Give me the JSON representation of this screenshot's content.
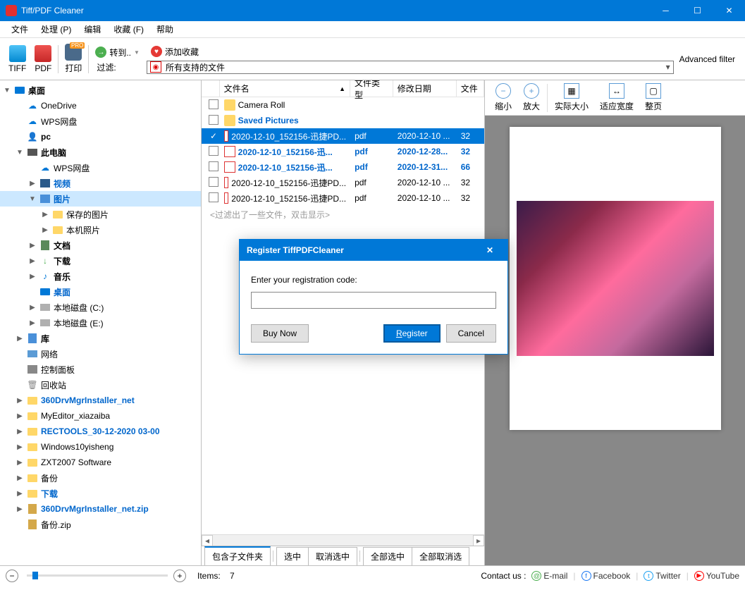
{
  "titlebar": {
    "title": "Tiff/PDF Cleaner"
  },
  "menu": [
    "文件",
    "处理 (P)",
    "编辑",
    "收藏 (F)",
    "帮助"
  ],
  "toolbar": {
    "tiff": "TIFF",
    "pdf": "PDF",
    "print": "打印",
    "pro": "PRO",
    "goto": "转到..",
    "addfav": "添加收藏",
    "filter_label": "过滤:",
    "filter_value": "所有支持的文件",
    "adv_filter": "Advanced filter"
  },
  "tree": [
    {
      "indent": 0,
      "exp": "▼",
      "icon": "desktop",
      "label": "桌面",
      "bold": true
    },
    {
      "indent": 1,
      "exp": "",
      "icon": "onedrive",
      "label": "OneDrive"
    },
    {
      "indent": 1,
      "exp": "",
      "icon": "wps",
      "label": "WPS网盘"
    },
    {
      "indent": 1,
      "exp": "",
      "icon": "user",
      "label": "pc",
      "bold": true
    },
    {
      "indent": 1,
      "exp": "▼",
      "icon": "pc",
      "label": "此电脑",
      "bold": true
    },
    {
      "indent": 2,
      "exp": "",
      "icon": "wps",
      "label": "WPS网盘"
    },
    {
      "indent": 2,
      "exp": "▶",
      "icon": "video",
      "label": "视频",
      "bold": true,
      "blue": true
    },
    {
      "indent": 2,
      "exp": "▼",
      "icon": "pictures",
      "label": "图片",
      "bold": true,
      "blue": true,
      "selected": true
    },
    {
      "indent": 3,
      "exp": "▶",
      "icon": "folder",
      "label": "保存的图片"
    },
    {
      "indent": 3,
      "exp": "▶",
      "icon": "folder",
      "label": "本机照片"
    },
    {
      "indent": 2,
      "exp": "▶",
      "icon": "docs",
      "label": "文档",
      "bold": true
    },
    {
      "indent": 2,
      "exp": "▶",
      "icon": "download",
      "label": "下载",
      "bold": true
    },
    {
      "indent": 2,
      "exp": "▶",
      "icon": "music",
      "label": "音乐",
      "bold": true
    },
    {
      "indent": 2,
      "exp": "",
      "icon": "desktop",
      "label": "桌面",
      "bold": true,
      "blue": true
    },
    {
      "indent": 2,
      "exp": "▶",
      "icon": "drive",
      "label": "本地磁盘 (C:)"
    },
    {
      "indent": 2,
      "exp": "▶",
      "icon": "drive",
      "label": "本地磁盘 (E:)"
    },
    {
      "indent": 1,
      "exp": "▶",
      "icon": "library",
      "label": "库",
      "bold": true
    },
    {
      "indent": 1,
      "exp": "",
      "icon": "network",
      "label": "网络"
    },
    {
      "indent": 1,
      "exp": "",
      "icon": "control",
      "label": "控制面板"
    },
    {
      "indent": 1,
      "exp": "",
      "icon": "recycle",
      "label": "回收站"
    },
    {
      "indent": 1,
      "exp": "▶",
      "icon": "folder",
      "label": "360DrvMgrInstaller_net",
      "bold": true,
      "blue": true
    },
    {
      "indent": 1,
      "exp": "▶",
      "icon": "folder",
      "label": "MyEditor_xiazaiba"
    },
    {
      "indent": 1,
      "exp": "▶",
      "icon": "folder",
      "label": "RECTOOLS_30-12-2020 03-00",
      "bold": true,
      "blue": true
    },
    {
      "indent": 1,
      "exp": "▶",
      "icon": "folder",
      "label": "Windows10yisheng"
    },
    {
      "indent": 1,
      "exp": "▶",
      "icon": "folder",
      "label": "ZXT2007 Software"
    },
    {
      "indent": 1,
      "exp": "▶",
      "icon": "folder",
      "label": "备份"
    },
    {
      "indent": 1,
      "exp": "▶",
      "icon": "folder",
      "label": "下载",
      "bold": true,
      "blue": true
    },
    {
      "indent": 1,
      "exp": "▶",
      "icon": "zip",
      "label": "360DrvMgrInstaller_net.zip",
      "bold": true,
      "blue": true
    },
    {
      "indent": 1,
      "exp": "",
      "icon": "zip",
      "label": "备份.zip"
    }
  ],
  "file_columns": {
    "name": "文件名",
    "type": "文件类型",
    "date": "修改日期",
    "size": "文件"
  },
  "files": [
    {
      "checked": false,
      "type": "folder",
      "name": "Camera Roll",
      "ftype": "",
      "date": "",
      "size": ""
    },
    {
      "checked": false,
      "type": "folder",
      "name": "Saved Pictures",
      "ftype": "",
      "date": "",
      "size": "",
      "blue": true
    },
    {
      "checked": true,
      "type": "pdf",
      "name": "2020-12-10_152156-迅捷PD...",
      "ftype": "pdf",
      "date": "2020-12-10 ...",
      "size": "32",
      "selected": true
    },
    {
      "checked": false,
      "type": "pdf",
      "name": "2020-12-10_152156-迅...",
      "ftype": "pdf",
      "date": "2020-12-28...",
      "size": "32",
      "blue": true
    },
    {
      "checked": false,
      "type": "pdf",
      "name": "2020-12-10_152156-迅...",
      "ftype": "pdf",
      "date": "2020-12-31...",
      "size": "66",
      "blue": true
    },
    {
      "checked": false,
      "type": "pdf",
      "name": "2020-12-10_152156-迅捷PD...",
      "ftype": "pdf",
      "date": "2020-12-10 ...",
      "size": "32"
    },
    {
      "checked": false,
      "type": "pdf",
      "name": "2020-12-10_152156-迅捷PD...",
      "ftype": "pdf",
      "date": "2020-12-10 ...",
      "size": "32"
    }
  ],
  "filter_note": "<过滤出了一些文件，双击显示>",
  "selection_bar": [
    "包含子文件夹",
    "选中",
    "取消选中",
    "全部选中",
    "全部取消选"
  ],
  "preview_toolbar": {
    "zoomout": "缩小",
    "zoomin": "放大",
    "actual": "实际大小",
    "fitwidth": "适应宽度",
    "fitpage": "整页"
  },
  "dialog": {
    "title": "Register TiffPDFCleaner",
    "prompt": "Enter your registration code:",
    "buy": "Buy Now",
    "register": "Register",
    "cancel": "Cancel"
  },
  "status": {
    "items_label": "Items:",
    "items_count": "7",
    "contact": "Contact us :",
    "links": [
      "E-mail",
      "Facebook",
      "Twitter",
      "YouTube"
    ]
  }
}
